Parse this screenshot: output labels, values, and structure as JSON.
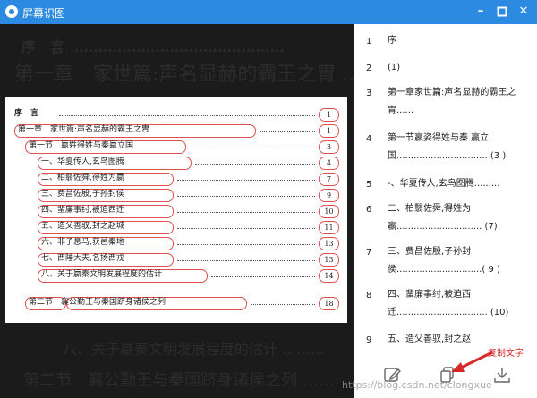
{
  "window": {
    "title": "屏幕识图",
    "icon": "app-logo-icon",
    "controls": [
      "minimize-icon",
      "maximize-icon",
      "close-icon"
    ]
  },
  "preview": {
    "bg_top": "序　言 ………………………………………",
    "bg_chapter": "第一章　家世篇:声名显赫的霸王之胄 ……",
    "bg_bottom1": "八、关于嬴秦文明发展程度的估计 ………",
    "bg_bottom2": "第二节　襄公勤王与秦国跻身诸侯之列 ……",
    "rows": [
      {
        "label": "序　言",
        "page": "1"
      },
      {
        "label": "第一章　家世篇:声名显赫的霸王之胄",
        "page": "1"
      },
      {
        "label": "第一节　嬴姓得姓与秦嬴立国",
        "page": "3"
      },
      {
        "label": "一、华夏传人,玄鸟图腾",
        "page": "4"
      },
      {
        "label": "二、柏翳佐舜,得姓为嬴",
        "page": "7"
      },
      {
        "label": "三、费昌佐殷,子孙封侯",
        "page": "9"
      },
      {
        "label": "四、蜚廉事纣,被迫西迁",
        "page": "10"
      },
      {
        "label": "五、造父善驭,封之赵城",
        "page": "11"
      },
      {
        "label": "六、非子息马,获邑秦地",
        "page": "13"
      },
      {
        "label": "七、西陲大夫,名扬西戎",
        "page": "13"
      },
      {
        "label": "八、关于嬴秦文明发展程度的估计",
        "page": "14"
      },
      {
        "label": "第二节　襄公勤王与秦国跻身诸侯之列",
        "page": "18"
      }
    ]
  },
  "results": [
    {
      "num": "1",
      "text": "序"
    },
    {
      "num": "2",
      "text": "(1)"
    },
    {
      "num": "3",
      "text": "第一章家世篇:声名显赫的霸王之胄......"
    },
    {
      "num": "4",
      "text": "第一节嬴姿得姓与秦 赢立国................................ (3 )"
    },
    {
      "num": "5",
      "text": "-、华夏传人,玄鸟图腾........."
    },
    {
      "num": "6",
      "text": "二、柏翳佐舜,得姓为嬴.............................. (7)"
    },
    {
      "num": "7",
      "text": "三、费昌佐殷,子孙封侯..............................( 9 )"
    },
    {
      "num": "8",
      "text": "四、蜚廉事纣,被迫西迁................................ (10)"
    },
    {
      "num": "9",
      "text": "五、造父善驭,封之赵"
    }
  ],
  "footer": {
    "edit_icon": "edit-icon",
    "copy_icon": "copy-icon",
    "download_icon": "download-icon",
    "copy_label": "复制文字"
  },
  "watermark": "https://blog.csdn.net/clongxue",
  "colors": {
    "titlebar": "#2c8ae0",
    "highlight_box": "#e05050",
    "annotation": "#d62828"
  }
}
